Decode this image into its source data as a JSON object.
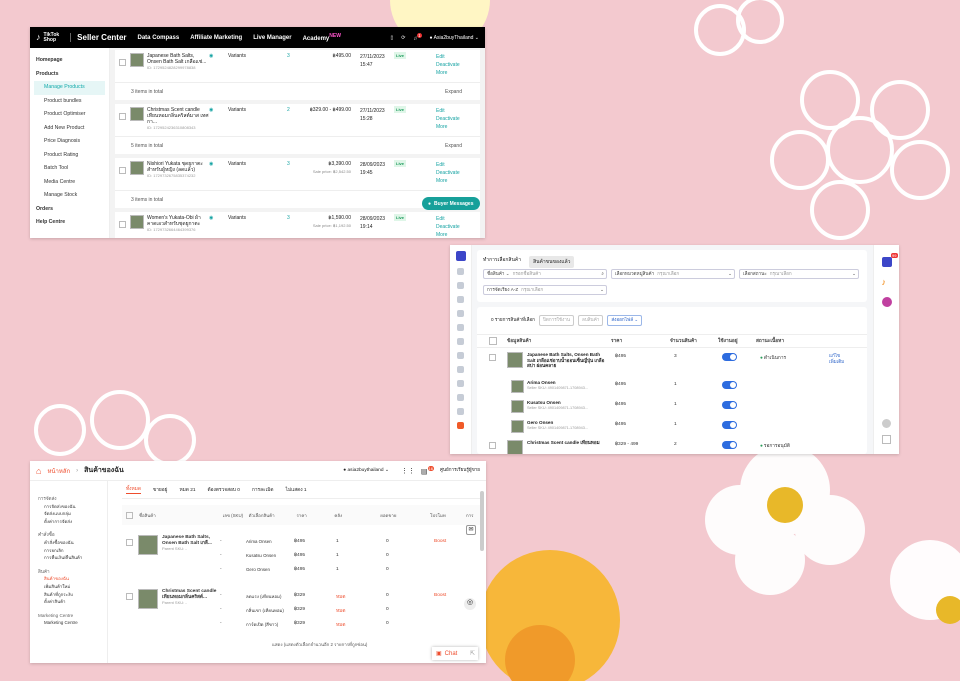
{
  "colors": {
    "background": "#f3c9cf",
    "tiktok_teal": "#15a3a3",
    "shopee_orange": "#ee4d2d",
    "lazada_blue": "#2d6cdf"
  },
  "tiktok": {
    "nav": {
      "brand": "Seller Center",
      "items": [
        "Data Compass",
        "Affiliate Marketing",
        "Live Manager",
        "Academy"
      ],
      "badge": "NEW",
      "notif_count": "1",
      "account": "Asia2buyThailand"
    },
    "sidebar": {
      "items": [
        {
          "label": "Homepage",
          "type": "group"
        },
        {
          "label": "Products",
          "type": "group"
        },
        {
          "label": "Manage Products",
          "type": "active"
        },
        {
          "label": "Product bundles",
          "type": "item"
        },
        {
          "label": "Product Optimiser",
          "type": "item"
        },
        {
          "label": "Add New Product",
          "type": "item"
        },
        {
          "label": "Price Diagnosis",
          "type": "item"
        },
        {
          "label": "Product Rating",
          "type": "item"
        },
        {
          "label": "Batch Tool",
          "type": "item"
        },
        {
          "label": "Media Centre",
          "type": "item"
        },
        {
          "label": "Manage Stock",
          "type": "item"
        },
        {
          "label": "Orders",
          "type": "group"
        },
        {
          "label": "Help Centre",
          "type": "group"
        }
      ]
    },
    "products": [
      {
        "name": "Japanese Bath Salts, Onsen Bath Salt เกลือแช่...",
        "id": "ID: 1729524828299978838",
        "variants": "Variants",
        "stock": "3",
        "price": "฿495.00",
        "sale": "",
        "date": "27/11/2023",
        "time": "15:47",
        "status": "Live",
        "actions": [
          "Edit",
          "Deactivate",
          "More"
        ],
        "total": "3 items in total",
        "expand": "Expand"
      },
      {
        "name": "Christmas Scent candle เทียนหอมกลิ่นคริสต์มาส เทศกา...",
        "id": "ID: 1729524236310808343",
        "variants": "Variants",
        "stock": "2",
        "price": "฿329.00 - ฿499.00",
        "sale": "",
        "date": "27/11/2023",
        "time": "15:28",
        "status": "Live",
        "actions": [
          "Edit",
          "Deactivate",
          "More"
        ],
        "total": "5 items in total",
        "expand": "Expand"
      },
      {
        "name": "Nishiori Yukata ชุดยูกาตะ สำหรับผู้หญิง (ลดแล้ว)",
        "id": "ID: 1729732675835374232",
        "variants": "Variants",
        "stock": "3",
        "price": "฿3,390.00",
        "sale": "Sale price: ฿2,542.50",
        "date": "28/09/2023",
        "time": "19:45",
        "status": "Live",
        "actions": [
          "Edit",
          "Deactivate",
          "More"
        ],
        "total": "3 items in total",
        "expand": "Expand"
      },
      {
        "name": "Women's Yukata-Obi ผ้าคาดเอวสำหรับชุดยูกาตะ",
        "id": "ID: 1729732664464399376",
        "variants": "Variants",
        "stock": "3",
        "price": "฿1,590.00",
        "sale": "Sale price: ฿1,192.50",
        "date": "28/09/2023",
        "time": "19:14",
        "status": "Live",
        "actions": [
          "Edit",
          "Deactivate",
          "More"
        ],
        "total": "",
        "expand": ""
      }
    ],
    "buyer_messages": "Buyer Messages"
  },
  "lazada": {
    "tabs": [
      "ทำการเลือกสินค้า",
      "สินค้าขนของแล้ว"
    ],
    "filters": {
      "product_name": "ชื่อสินค้า",
      "product_name_ph": "กรอกชื่อสินค้า",
      "category": "เลือกหมวดหมู่สินค้า",
      "category_ph": "กรุณาเลือก",
      "status": "เลือกสถานะ",
      "status_ph": "กรุณาเลือก",
      "sort": "การจัดเรียง A-Z",
      "sort_ph": "กรุณาเลือก"
    },
    "toolbar": {
      "selected": "0 รายการสินค้าที่เลือก",
      "btn1": "ปิดการใช้งาน",
      "btn2": "ลบสินค้า",
      "btn3": "ส่งออกไฟล์"
    },
    "headers": [
      "ข้อมูลสินค้า",
      "ราคา",
      "จำนวนสินค้า",
      "ใช้งานอยู่",
      "สถานะเนื้อหา"
    ],
    "rows": [
      {
        "name": "Japanese Bath Salts, Onsen Bath Salt เกลือแช่อาบน้ำออนเซ็นญี่ปุ่น เกลือสปา ผ่อนคลาย",
        "price": "฿495",
        "qty": "3",
        "status": "ดำเนินการ",
        "act1": "แก้ไข",
        "act2": "เพิ่มเติม"
      },
      {
        "name": "Arima Onsen",
        "price": "฿495",
        "qty": "1",
        "sku": "Seller SKU: 4901409871-1708943..."
      },
      {
        "name": "Kusatsu Onsen",
        "price": "฿495",
        "qty": "1",
        "sku": "Seller SKU: 4901409871-1708943..."
      },
      {
        "name": "Gero Onsen",
        "price": "฿495",
        "qty": "1",
        "sku": "Seller SKU: 4901409871-1708943..."
      },
      {
        "name": "Christmas Scent candle เทียนหอม",
        "price": "฿329 - 499",
        "qty": "2",
        "status": "รอการอนุมัติ"
      }
    ],
    "notif_count": "99"
  },
  "shopee": {
    "breadcrumb": "หน้าหลัก",
    "title": "สินค้าของฉัน",
    "account": "asia2buythailand",
    "notif_count": "16",
    "help": "ศูนย์การเรียนรู้ผู้ขาย",
    "sidebar": {
      "groups": [
        {
          "h": "การจัดส่ง",
          "items": [
            "การจัดส่งของฉัน",
            "จัดส่งแบบกลุ่ม",
            "ตั้งค่าการจัดส่ง"
          ]
        },
        {
          "h": "คำสั่งซื้อ",
          "items": [
            "คำสั่งซื้อของฉัน",
            "การยกเลิก",
            "การคืนเงิน/คืนสินค้า"
          ]
        },
        {
          "h": "สินค้า",
          "items": [
            "สินค้าของฉัน",
            "เพิ่มสินค้าใหม่",
            "สินค้าที่ถูกระงับ",
            "ตั้งค่าสินค้า"
          ]
        },
        {
          "h": "Marketing Centre",
          "items": [
            "Marketing Centre"
          ]
        }
      ]
    },
    "tabs": [
      "ทั้งหมด",
      "ขายอยู่",
      "หมด 21",
      "ต้องตรวจสอบ 0",
      "การละเมิด",
      "ไม่แสดง 1"
    ],
    "headers": [
      "ชื่อสินค้า",
      "เลข (SKU)",
      "ตัวเลือกสินค้า",
      "ราคา",
      "คลัง",
      "ยอดขาย",
      "โปรโมท",
      "การ"
    ],
    "products": [
      {
        "name": "Japanese Bath Salts, Onsen Bath Salt เกลื...",
        "parent": "Parent SKU: -",
        "variants": [
          {
            "v": "Arima Onsen",
            "p": "฿495",
            "s": "1",
            "sold": "0"
          },
          {
            "v": "Kusatsu Onsen",
            "p": "฿495",
            "s": "1",
            "sold": "0"
          },
          {
            "v": "Gero Onsen",
            "p": "฿495",
            "s": "1",
            "sold": "0"
          }
        ],
        "boost": "Boost"
      },
      {
        "name": "Christmas Scent candle เทียนหอมกลิ่นคริสต์...",
        "parent": "Parent SKU: -",
        "variants": [
          {
            "v": "ลดแรง (เทียนหอม)",
            "p": "฿329",
            "s": "หมด",
            "sold": "0"
          },
          {
            "v": "กลิ่นเขา (เทียนหอม)",
            "p": "฿329",
            "s": "หมด",
            "sold": "0"
          },
          {
            "v": "การ์ดเปิด (สีขาว)",
            "p": "฿329",
            "s": "หมด",
            "sold": "0"
          }
        ],
        "boost": "Boost"
      }
    ],
    "more": "แสดง (แสดงตัวเลือกจำนวนอีก 2 รายการที่ถูกซ่อน)",
    "chat": "Chat"
  }
}
